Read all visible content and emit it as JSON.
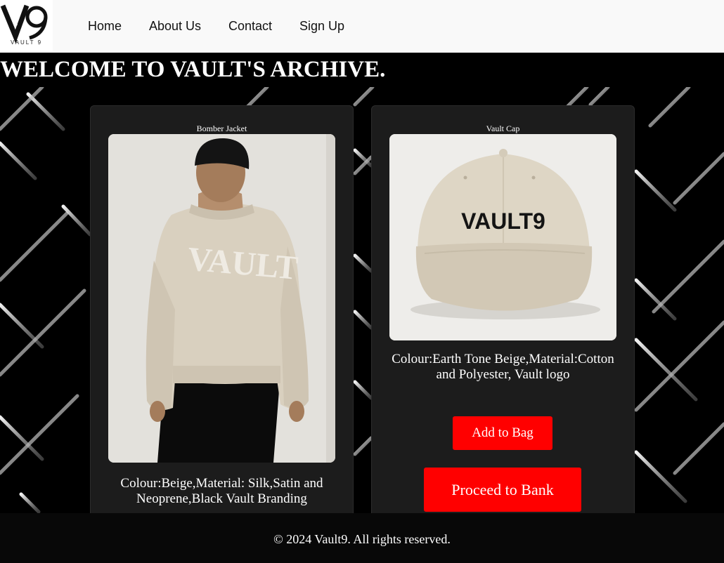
{
  "nav": {
    "logo_mark": "V9",
    "logo_sub": "VAULT 9",
    "links": [
      {
        "label": "Home"
      },
      {
        "label": "About Us"
      },
      {
        "label": "Contact"
      },
      {
        "label": "Sign Up"
      }
    ]
  },
  "hero": {
    "heading": "WELCOME TO VAULT'S ARCHIVE."
  },
  "products": [
    {
      "title": "Bomber Jacket",
      "image_text": "VAULT",
      "description": "Colour:Beige,Material: Silk,Satin and Neoprene,Black Vault Branding"
    },
    {
      "title": "Vault Cap",
      "image_text": "VAULT9",
      "description": "Colour:Earth Tone Beige,Material:Cotton and Polyester, Vault logo",
      "add_label": "Add to Bag",
      "proceed_label": "Proceed to Bank"
    }
  ],
  "footer": {
    "text": "© 2024 Vault9. All rights reserved."
  },
  "colors": {
    "accent": "#ff0000",
    "card": "#1c1c1c",
    "nav_bg": "#f9f9f9",
    "beige": "#d9d0bf"
  }
}
